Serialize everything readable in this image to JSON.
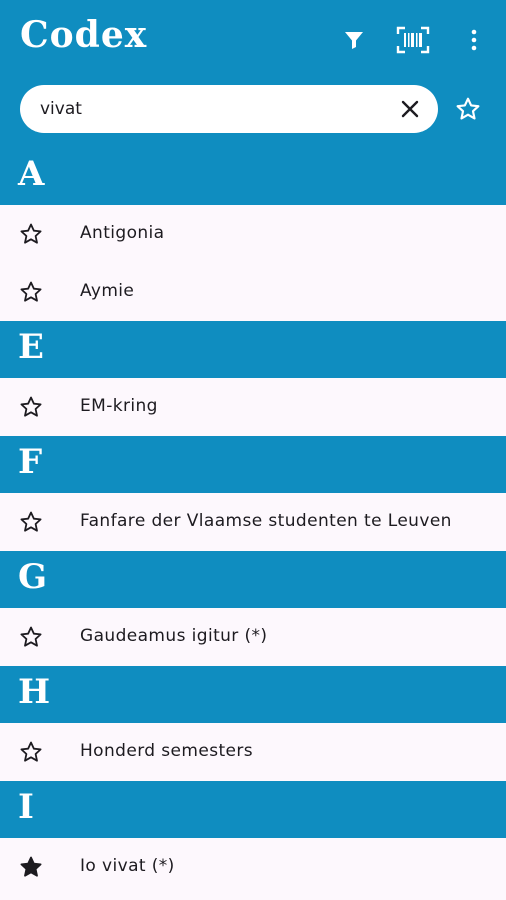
{
  "header": {
    "title": "Codex",
    "filter_icon": "filter-icon",
    "scan_icon": "barcode-scan-icon",
    "menu_icon": "more-vert-icon",
    "background": "#0f8dc0"
  },
  "search": {
    "value": "vivat",
    "placeholder": "",
    "clear_icon": "close-icon",
    "favorites_filter_icon": "star-outline-icon"
  },
  "sections": [
    {
      "letter": "A",
      "items": [
        {
          "label": "Antigonia",
          "starred": false
        },
        {
          "label": "Aymie",
          "starred": false
        }
      ]
    },
    {
      "letter": "E",
      "items": [
        {
          "label": "EM-kring",
          "starred": false
        }
      ]
    },
    {
      "letter": "F",
      "items": [
        {
          "label": "Fanfare der Vlaamse studenten te Leuven",
          "starred": false
        }
      ]
    },
    {
      "letter": "G",
      "items": [
        {
          "label": "Gaudeamus igitur (*)",
          "starred": false
        }
      ]
    },
    {
      "letter": "H",
      "items": [
        {
          "label": "Honderd semesters",
          "starred": false
        }
      ]
    },
    {
      "letter": "I",
      "items": [
        {
          "label": "Io vivat (*)",
          "starred": true
        }
      ]
    }
  ]
}
